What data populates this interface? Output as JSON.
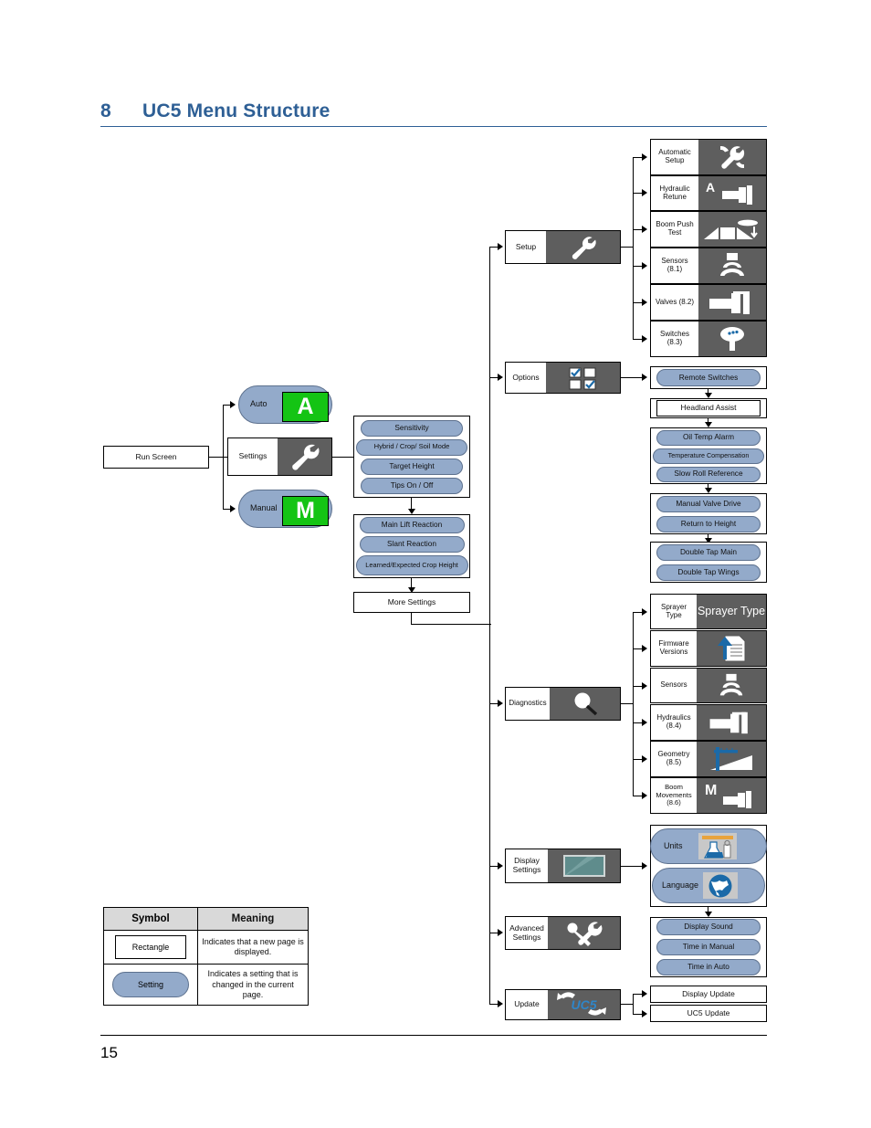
{
  "heading": {
    "number": "8",
    "title": "UC5 Menu Structure"
  },
  "page_number": "15",
  "flow": {
    "run_screen": "Run Screen",
    "modes": [
      {
        "label": "Auto",
        "icon": "green-A-icon",
        "glyph": "A"
      },
      {
        "label": "Manual",
        "icon": "green-M-icon",
        "glyph": "M"
      }
    ],
    "settings": {
      "label": "Settings",
      "icon": "wrench-icon"
    },
    "settings_group_1": [
      "Sensitivity",
      "Hybrid / Crop/ Soil Mode",
      "Target Height",
      "Tips On / Off"
    ],
    "settings_group_2": [
      "Main Lift Reaction",
      "Slant Reaction",
      "Learned/Expected Crop Height"
    ],
    "more_settings": "More Settings"
  },
  "menu": [
    {
      "label": "Setup",
      "icon": "wrench-icon"
    },
    {
      "label": "Options",
      "icon": "checkboxes-icon"
    },
    {
      "label": "Diagnostics",
      "icon": "magnifier-icon"
    },
    {
      "label": "Display Settings",
      "icon": "monitor-icon"
    },
    {
      "label": "Advanced Settings",
      "icon": "wrench-screwdriver-icon"
    },
    {
      "label": "Update",
      "icon": "uc5-refresh-icon",
      "icon_text": "UC5"
    }
  ],
  "setup_items": [
    {
      "label": "Automatic Setup",
      "icon": "auto-setup-icon"
    },
    {
      "label": "Hydraulic Retune",
      "icon": "hydraulic-retune-icon"
    },
    {
      "label": "Boom Push Test",
      "icon": "boom-push-test-icon"
    },
    {
      "label": "Sensors (8.1)",
      "icon": "sensor-waves-icon"
    },
    {
      "label": "Valves (8.2)",
      "icon": "valve-icon"
    },
    {
      "label": "Switches (8.3)",
      "icon": "switch-icon"
    }
  ],
  "options_groups": [
    {
      "type": "pill",
      "items": [
        "Remote Switches"
      ]
    },
    {
      "type": "rect",
      "items": [
        "Headland Assist"
      ]
    },
    {
      "type": "pill",
      "items": [
        "Oil Temp Alarm",
        "Temperature Compensation",
        "Slow Roll Reference"
      ]
    },
    {
      "type": "pill",
      "items": [
        "Manual Valve Drive",
        "Return to Height"
      ]
    },
    {
      "type": "pill",
      "items": [
        "Double Tap Main",
        "Double Tap Wings"
      ]
    }
  ],
  "diagnostics_items": [
    {
      "label": "Sprayer Type",
      "icon": "sprayer-type-icon",
      "icon_text": "Sprayer Type"
    },
    {
      "label": "Firmware Versions",
      "icon": "firmware-upload-icon"
    },
    {
      "label": "Sensors",
      "icon": "sensor-waves-icon"
    },
    {
      "label": "Hydraulics (8.4)",
      "icon": "valve-icon"
    },
    {
      "label": "Geometry (8.5)",
      "icon": "geometry-icon"
    },
    {
      "label": "Boom Movements (8.6)",
      "icon": "boom-movement-M-icon"
    }
  ],
  "display_items": [
    {
      "label": "Units",
      "icon": "flask-icon"
    },
    {
      "label": "Language",
      "icon": "globe-icon"
    }
  ],
  "advanced_items": [
    "Display Sound",
    "Time in Manual",
    "Time in Auto"
  ],
  "update_items": [
    "Display Update",
    "UC5 Update"
  ],
  "legend": {
    "headers": [
      "Symbol",
      "Meaning"
    ],
    "rows": [
      {
        "symbol": "Rectangle",
        "meaning": "Indicates that a new page is displayed."
      },
      {
        "symbol": "Setting",
        "meaning": "Indicates a setting that is changed in the current page."
      }
    ]
  },
  "colors": {
    "heading": "#2e5f95",
    "pill": "#93aaca",
    "icon_bg": "#5e5e5e",
    "green": "#14c414"
  }
}
